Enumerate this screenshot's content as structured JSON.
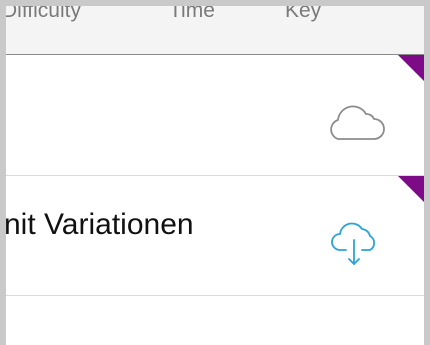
{
  "header": {
    "columns": [
      "Difficulty",
      "Time",
      "Key"
    ]
  },
  "rows": [
    {
      "title": "",
      "icon": "cloud-icon",
      "icon_color": "#8c8c8c"
    },
    {
      "title": "nit Variationen",
      "icon": "cloud-download-icon",
      "icon_color": "#2aa3d6"
    }
  ],
  "colors": {
    "accent_corner": "#7d0a86",
    "header_bg": "#f4f4f4",
    "download_blue": "#2aa3d6"
  }
}
